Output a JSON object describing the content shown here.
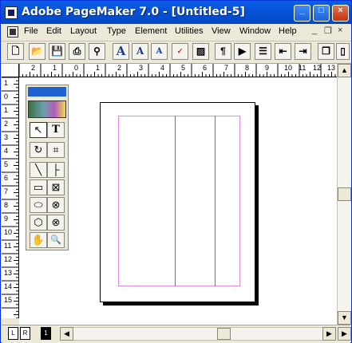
{
  "window": {
    "title": "Adobe PageMaker 7.0 - [Untitled-5]"
  },
  "title_buttons": {
    "minimize": "_",
    "maximize": "□",
    "close": "×"
  },
  "menu": {
    "items": [
      "File",
      "Edit",
      "Layout",
      "Type",
      "Element",
      "Utilities",
      "View",
      "Window",
      "Help"
    ],
    "doc_controls": [
      "_",
      "❐",
      "×"
    ]
  },
  "toolbar": {
    "buttons": [
      "new-icon",
      "open-icon",
      "save-icon",
      "print-icon",
      "find-icon",
      "font-icon",
      "font-larger-icon",
      "font-smaller-icon",
      "spell-icon",
      "fill-icon",
      "pilcrow-icon",
      "text-flow-icon",
      "bullets-icon",
      "indent-left-icon",
      "indent-right-icon",
      "copy-icon",
      "page-icon"
    ],
    "labels": {
      "font": "A",
      "font_larger": "A",
      "font_smaller": "A",
      "pilcrow": "¶"
    }
  },
  "ruler": {
    "h_labels": [
      "2",
      "1",
      "0",
      "1",
      "2",
      "3",
      "4",
      "5",
      "6",
      "7",
      "8",
      "9",
      "10",
      "11",
      "12",
      "13"
    ],
    "v_labels": [
      "1",
      "0",
      "1",
      "2",
      "3",
      "4",
      "5",
      "6",
      "7",
      "8",
      "9",
      "10",
      "11",
      "12",
      "13",
      "14",
      "15"
    ]
  },
  "toolbox": {
    "tools": [
      {
        "name": "pointer-tool",
        "glyph": "↖",
        "selected": true
      },
      {
        "name": "text-tool",
        "glyph": "T",
        "selected": false
      },
      {
        "name": "rotate-tool",
        "glyph": "↻",
        "selected": false
      },
      {
        "name": "crop-tool",
        "glyph": "⌗",
        "selected": false
      },
      {
        "name": "line-tool",
        "glyph": "╲",
        "selected": false
      },
      {
        "name": "constrained-line-tool",
        "glyph": "├",
        "selected": false
      },
      {
        "name": "rectangle-tool",
        "glyph": "▭",
        "selected": false
      },
      {
        "name": "rectangle-frame-tool",
        "glyph": "⊠",
        "selected": false
      },
      {
        "name": "ellipse-tool",
        "glyph": "⬭",
        "selected": false
      },
      {
        "name": "ellipse-frame-tool",
        "glyph": "⊗",
        "selected": false
      },
      {
        "name": "polygon-tool",
        "glyph": "⬡",
        "selected": false
      },
      {
        "name": "polygon-frame-tool",
        "glyph": "⊗",
        "selected": false
      },
      {
        "name": "hand-tool",
        "glyph": "✋",
        "selected": false
      },
      {
        "name": "zoom-tool",
        "glyph": "🔍",
        "selected": false
      }
    ]
  },
  "pages": {
    "left": "L",
    "right": "R",
    "current": "1"
  },
  "colors": {
    "margin": "#e08ad8",
    "column_guide": "#6b6bdf",
    "title_bar": "#0653d6"
  }
}
